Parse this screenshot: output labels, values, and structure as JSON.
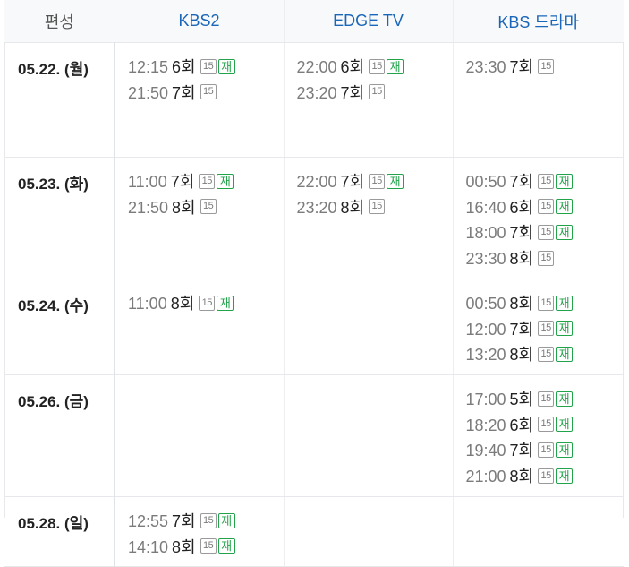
{
  "header": {
    "label": "편성",
    "channels": [
      "KBS2",
      "EDGE TV",
      "KBS 드라마"
    ]
  },
  "badges": {
    "rating": "15",
    "rerun": "재"
  },
  "rows": [
    {
      "date": "05.22. (월)",
      "cells": [
        [
          {
            "time": "12:15",
            "ep": "6회",
            "rating": true,
            "rerun": true
          },
          {
            "time": "21:50",
            "ep": "7회",
            "rating": true,
            "rerun": false
          }
        ],
        [
          {
            "time": "22:00",
            "ep": "6회",
            "rating": true,
            "rerun": true
          },
          {
            "time": "23:20",
            "ep": "7회",
            "rating": true,
            "rerun": false
          }
        ],
        [
          {
            "time": "23:30",
            "ep": "7회",
            "rating": true,
            "rerun": false
          }
        ]
      ]
    },
    {
      "date": "05.23. (화)",
      "cells": [
        [
          {
            "time": "11:00",
            "ep": "7회",
            "rating": true,
            "rerun": true
          },
          {
            "time": "21:50",
            "ep": "8회",
            "rating": true,
            "rerun": false
          }
        ],
        [
          {
            "time": "22:00",
            "ep": "7회",
            "rating": true,
            "rerun": true
          },
          {
            "time": "23:20",
            "ep": "8회",
            "rating": true,
            "rerun": false
          }
        ],
        [
          {
            "time": "00:50",
            "ep": "7회",
            "rating": true,
            "rerun": true
          },
          {
            "time": "16:40",
            "ep": "6회",
            "rating": true,
            "rerun": true
          },
          {
            "time": "18:00",
            "ep": "7회",
            "rating": true,
            "rerun": true
          },
          {
            "time": "23:30",
            "ep": "8회",
            "rating": true,
            "rerun": false
          }
        ]
      ]
    },
    {
      "date": "05.24. (수)",
      "cells": [
        [
          {
            "time": "11:00",
            "ep": "8회",
            "rating": true,
            "rerun": true
          }
        ],
        [],
        [
          {
            "time": "00:50",
            "ep": "8회",
            "rating": true,
            "rerun": true
          },
          {
            "time": "12:00",
            "ep": "7회",
            "rating": true,
            "rerun": true
          },
          {
            "time": "13:20",
            "ep": "8회",
            "rating": true,
            "rerun": true
          }
        ]
      ]
    },
    {
      "date": "05.26. (금)",
      "cells": [
        [],
        [],
        [
          {
            "time": "17:00",
            "ep": "5회",
            "rating": true,
            "rerun": true
          },
          {
            "time": "18:20",
            "ep": "6회",
            "rating": true,
            "rerun": true
          },
          {
            "time": "19:40",
            "ep": "7회",
            "rating": true,
            "rerun": true
          },
          {
            "time": "21:00",
            "ep": "8회",
            "rating": true,
            "rerun": true
          }
        ]
      ]
    },
    {
      "date": "05.28. (일)",
      "cells": [
        [
          {
            "time": "12:55",
            "ep": "7회",
            "rating": true,
            "rerun": true
          },
          {
            "time": "14:10",
            "ep": "8회",
            "rating": true,
            "rerun": true
          }
        ],
        [],
        []
      ]
    }
  ]
}
